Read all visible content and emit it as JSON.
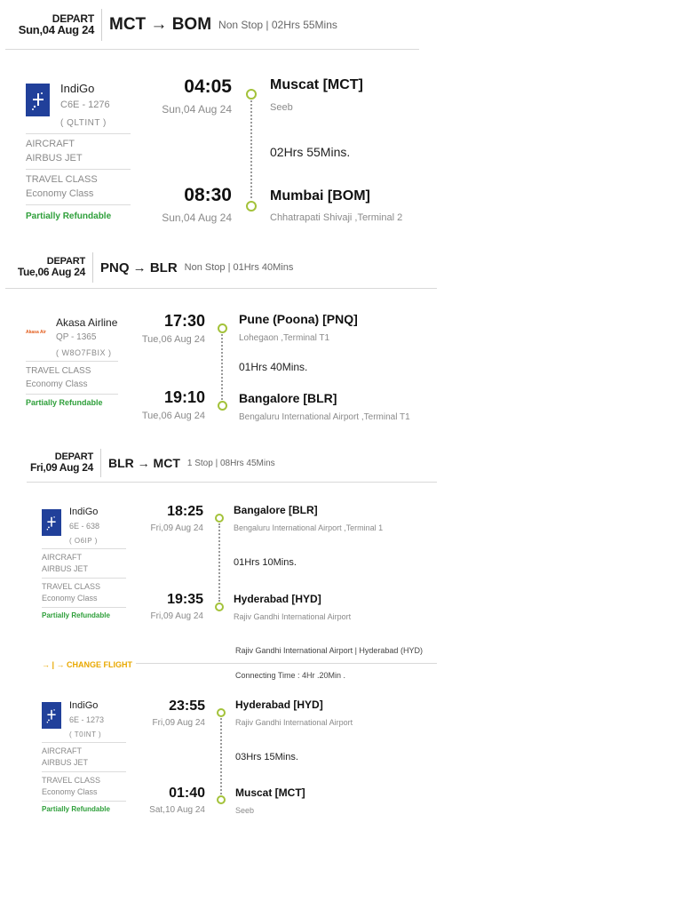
{
  "depart_label": "DEPART",
  "refund_label": "Partially Refundable",
  "aircraft_label": "AIRCRAFT",
  "travel_class_label": "TRAVEL CLASS",
  "accent_color": "#a3c23a",
  "refund_color": "#2e9f3a",
  "segments": [
    {
      "date": "Sun,04 Aug 24",
      "route": "MCT → BOM",
      "info": "Non Stop | 02Hrs 55Mins",
      "legs": [
        {
          "airline": "IndiGo",
          "flight_no": "C6E - 1276",
          "code": "( QLTINT )",
          "aircraft": "AIRBUS JET",
          "travel_class": "Economy Class",
          "dep_time": "04:05",
          "dep_date": "Sun,04 Aug 24",
          "dep_city": "Muscat [MCT]",
          "dep_airport": "Seeb",
          "duration": "02Hrs 55Mins.",
          "arr_time": "08:30",
          "arr_date": "Sun,04 Aug 24",
          "arr_city": "Mumbai [BOM]",
          "arr_airport": "Chhatrapati Shivaji ,Terminal 2"
        }
      ]
    },
    {
      "date": "Tue,06 Aug 24",
      "route": "PNQ → BLR",
      "info": "Non Stop | 01Hrs 40Mins",
      "legs": [
        {
          "airline": "Akasa Airline",
          "logo_text": "Akasa Air",
          "flight_no": "QP - 1365",
          "code": "( W8O7FBIX )",
          "travel_class": "Economy Class",
          "dep_time": "17:30",
          "dep_date": "Tue,06 Aug 24",
          "dep_city": "Pune (Poona) [PNQ]",
          "dep_airport": "Lohegaon ,Terminal T1",
          "duration": "01Hrs 40Mins.",
          "arr_time": "19:10",
          "arr_date": "Tue,06 Aug 24",
          "arr_city": "Bangalore [BLR]",
          "arr_airport": "Bengaluru International Airport ,Terminal T1"
        }
      ]
    },
    {
      "date": "Fri,09 Aug 24",
      "route": "BLR → MCT",
      "info": "1 Stop | 08Hrs 45Mins",
      "legs": [
        {
          "airline": "IndiGo",
          "flight_no": "6E - 638",
          "code": "( O6IP )",
          "aircraft": "AIRBUS JET",
          "travel_class": "Economy Class",
          "dep_time": "18:25",
          "dep_date": "Fri,09 Aug 24",
          "dep_city": "Bangalore [BLR]",
          "dep_airport": "Bengaluru International Airport ,Terminal 1",
          "duration": "01Hrs 10Mins.",
          "arr_time": "19:35",
          "arr_date": "Fri,09 Aug 24",
          "arr_city": "Hyderabad [HYD]",
          "arr_airport": "Rajiv Gandhi International Airport"
        },
        {
          "airline": "IndiGo",
          "flight_no": "6E - 1273",
          "code": "( T0INT )",
          "aircraft": "AIRBUS JET",
          "travel_class": "Economy Class",
          "dep_time": "23:55",
          "dep_date": "Fri,09 Aug 24",
          "dep_city": "Hyderabad [HYD]",
          "dep_airport": "Rajiv Gandhi International Airport",
          "duration": "03Hrs 15Mins.",
          "arr_time": "01:40",
          "arr_date": "Sat,10 Aug 24",
          "arr_city": "Muscat [MCT]",
          "arr_airport": "Seeb"
        }
      ],
      "layover": {
        "airport": "Rajiv Gandhi International Airport | Hyderabad (HYD)",
        "change_label": "→ | → CHANGE FLIGHT",
        "connecting_time": "Connecting Time : 4Hr .20Min ."
      }
    }
  ]
}
